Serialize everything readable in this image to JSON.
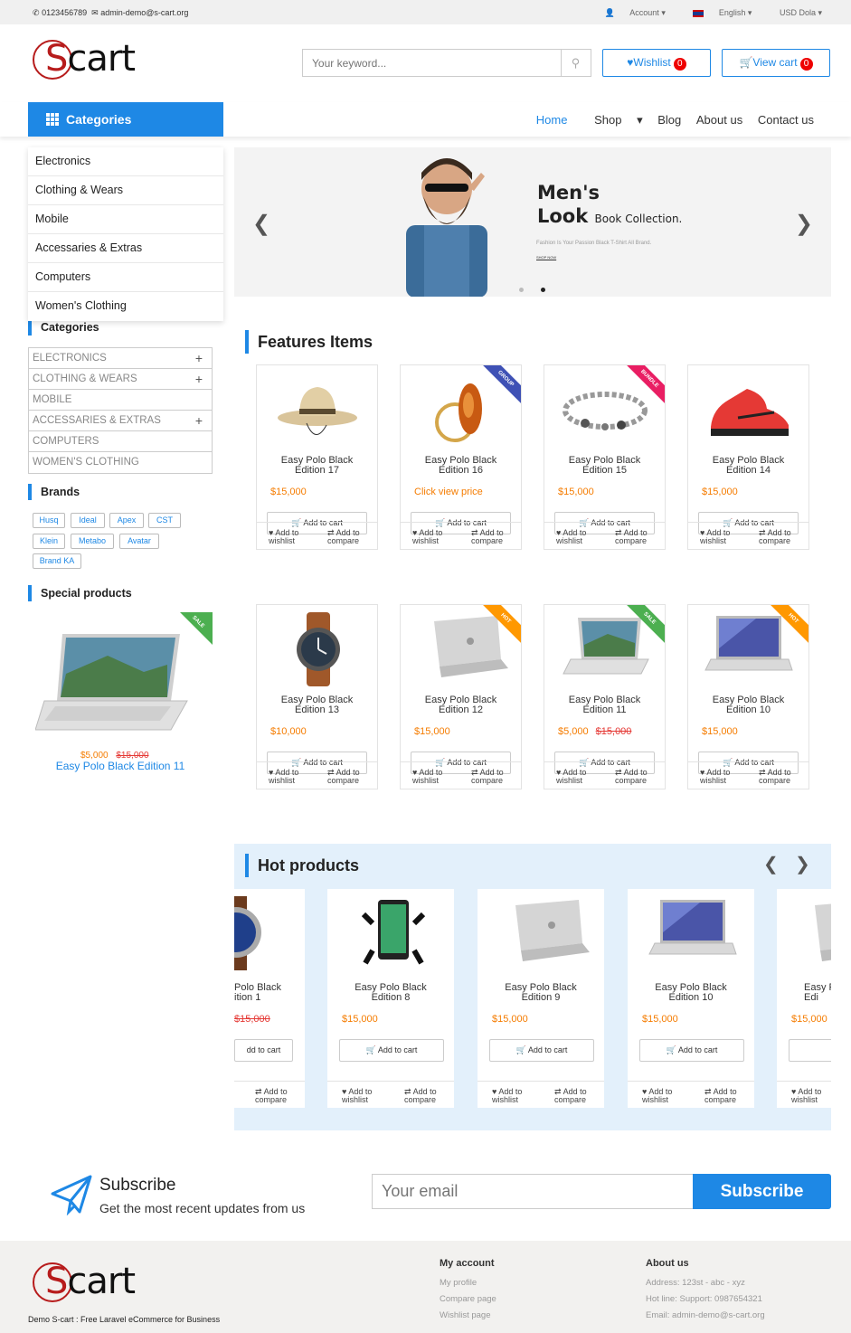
{
  "topbar": {
    "phone": "0123456789",
    "email": "admin-demo@s-cart.org",
    "account": "Account",
    "language": "English",
    "currency": "USD Dola"
  },
  "logo": {
    "text_s": "S",
    "text_rest": "cart"
  },
  "search": {
    "placeholder": "Your keyword..."
  },
  "header": {
    "wishlist_label": "Wishlist",
    "wishlist_count": "0",
    "cart_label": "View cart",
    "cart_count": "0"
  },
  "nav": {
    "categories_label": "Categories",
    "items": [
      "Home",
      "Shop",
      "Blog",
      "About us",
      "Contact us"
    ]
  },
  "category_menu": [
    "Electronics",
    "Clothing & Wears",
    "Mobile",
    "Accessaries & Extras",
    "Computers",
    "Women's Clothing"
  ],
  "banner": {
    "title1": "Men's",
    "title2": "Look",
    "title2_small": "Book Collection.",
    "tagline": "Fashion Is Your Passion Black T-Shirt All Brand.",
    "cta": "SHOP NOW"
  },
  "sidebar": {
    "categories_title": "Categories",
    "categories": [
      {
        "label": "ELECTRONICS",
        "expand": "+"
      },
      {
        "label": "CLOTHING & WEARS",
        "expand": "+"
      },
      {
        "label": "MOBILE",
        "expand": ""
      },
      {
        "label": "ACCESSARIES & EXTRAS",
        "expand": "+"
      },
      {
        "label": "COMPUTERS",
        "expand": ""
      },
      {
        "label": "WOMEN'S CLOTHING",
        "expand": ""
      }
    ],
    "brands_title": "Brands",
    "brands": [
      "Husq",
      "Ideal",
      "Apex",
      "CST",
      "Klein",
      "Metabo",
      "Avatar",
      "Brand KA"
    ],
    "special_title": "Special products",
    "special": {
      "price": "$5,000",
      "old_price": "$15,000",
      "name": "Easy Polo Black Edition 11",
      "ribbon": "SALE"
    }
  },
  "features": {
    "title": "Features Items",
    "products": [
      {
        "name": "Easy Polo Black Edition 17",
        "price": "$15,000",
        "old": "",
        "ribbon": ""
      },
      {
        "name": "Easy Polo Black Edition 16",
        "price": "Click view price",
        "old": "",
        "ribbon": "GROUP"
      },
      {
        "name": "Easy Polo Black Edition 15",
        "price": "$15,000",
        "old": "",
        "ribbon": "BUNDLE"
      },
      {
        "name": "Easy Polo Black Edition 14",
        "price": "$15,000",
        "old": "",
        "ribbon": ""
      },
      {
        "name": "Easy Polo Black Edition 13",
        "price": "$10,000",
        "old": "",
        "ribbon": ""
      },
      {
        "name": "Easy Polo Black Edition 12",
        "price": "$15,000",
        "old": "",
        "ribbon": "HOT"
      },
      {
        "name": "Easy Polo Black Edition 11",
        "price": "$5,000",
        "old": "$15,000",
        "ribbon": "SALE"
      },
      {
        "name": "Easy Polo Black Edition 10",
        "price": "$15,000",
        "old": "",
        "ribbon": "HOT"
      }
    ],
    "add_to_cart": "Add to cart",
    "wishlist_a": "Add to",
    "wishlist_b": "wishlist",
    "compare_a": "Add to",
    "compare_b": "compare"
  },
  "hot": {
    "title": "Hot products",
    "products": [
      {
        "name_a": "Polo Black",
        "name_b": "ition 1",
        "price": "",
        "old": "$15,000",
        "cart": "dd to cart"
      },
      {
        "name_a": "Easy Polo Black",
        "name_b": "Edition 8",
        "price": "$15,000",
        "old": "",
        "cart": "Add to cart"
      },
      {
        "name_a": "Easy Polo Black",
        "name_b": "Edition 9",
        "price": "$15,000",
        "old": "",
        "cart": "Add to cart"
      },
      {
        "name_a": "Easy Polo Black",
        "name_b": "Edition 10",
        "price": "$15,000",
        "old": "",
        "cart": "Add to cart"
      },
      {
        "name_a": "Easy P",
        "name_b": "Edi",
        "price": "$15,000",
        "old": "",
        "cart": "A"
      }
    ]
  },
  "subscribe": {
    "title": "Subscribe",
    "subtitle": "Get the most recent updates from us",
    "placeholder": "Your email",
    "button": "Subscribe"
  },
  "footer": {
    "tagline": "Demo S-cart : Free Laravel eCommerce for Business",
    "my_account_title": "My account",
    "my_account": [
      "My profile",
      "Compare page",
      "Wishlist page"
    ],
    "about_title": "About us",
    "about": [
      "Address: 123st - abc - xyz",
      "Hot line: Support: 0987654321",
      "Email: admin-demo@s-cart.org"
    ]
  },
  "colors": {
    "accent": "#1e88e5",
    "price": "#f57c00",
    "sale": "#4caf50",
    "hot": "#ff9800",
    "group": "#3f51b5",
    "bundle": "#e91e63"
  }
}
